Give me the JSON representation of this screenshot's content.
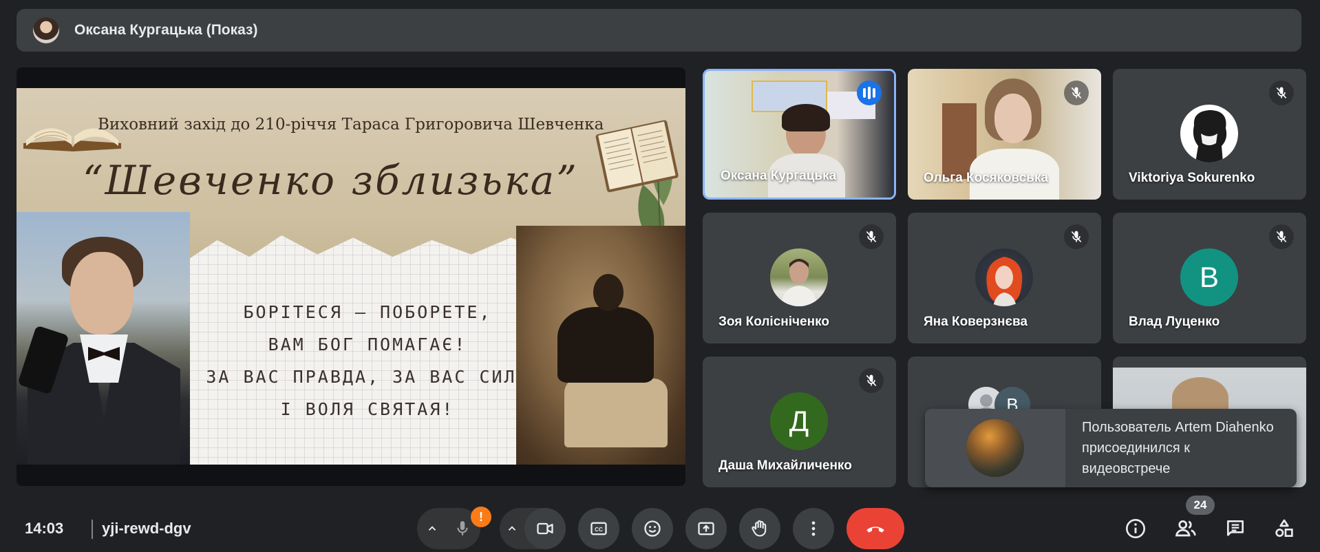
{
  "presenter_bar": {
    "title": "Оксана Кургацька (Показ)"
  },
  "slide": {
    "subtitle": "Виховний захід до 210-річчя Тараса Григоровича Шевченка",
    "main_title": "“Шевченко зблизька”",
    "quote_lines": [
      "Борітеся — поборете,",
      "вам Бог помагає!",
      "За вас правда, за вас сила",
      "і воля святая!"
    ]
  },
  "participants": [
    {
      "name": "Оксана Кургацька",
      "state": "speaking"
    },
    {
      "name": "Ольга Косяковська",
      "state": "muted"
    },
    {
      "name": "Viktoriya Sokurenko",
      "state": "muted"
    },
    {
      "name": "Зоя Колісніченко",
      "state": "muted"
    },
    {
      "name": "Яна Коверзнєва",
      "state": "muted"
    },
    {
      "name": "Влад Луценко",
      "state": "muted",
      "initial": "В",
      "color": "#129382"
    },
    {
      "name": "Даша Михайличенко",
      "state": "muted",
      "initial": "Д",
      "color": "#33691e"
    },
    {
      "name": "",
      "state": "group",
      "initial": "В"
    },
    {
      "name": "",
      "state": "video"
    }
  ],
  "toast": {
    "message": "Пользователь Artem Diahenko присоединился к видеовстрече"
  },
  "bottom_bar": {
    "time": "14:03",
    "meeting_code": "yji-rewd-dgv",
    "mic_warning": "!",
    "people_count": "24"
  },
  "colors": {
    "background": "#202124",
    "tile": "#3c4043",
    "active_border": "#8ab4f8",
    "speaking_blue": "#1a73e8",
    "end_call": "#ea4335",
    "warning": "#fa7b17"
  },
  "icons": {
    "mic": "mic-off-icon",
    "camera": "videocam-icon",
    "captions": "closed-caption-icon",
    "emoji": "emoji-icon",
    "present": "present-screen-icon",
    "hand": "raise-hand-icon",
    "more": "more-vert-icon",
    "end": "call-end-icon",
    "info": "info-icon",
    "people": "people-icon",
    "chat": "chat-icon",
    "activities": "activities-icon"
  }
}
